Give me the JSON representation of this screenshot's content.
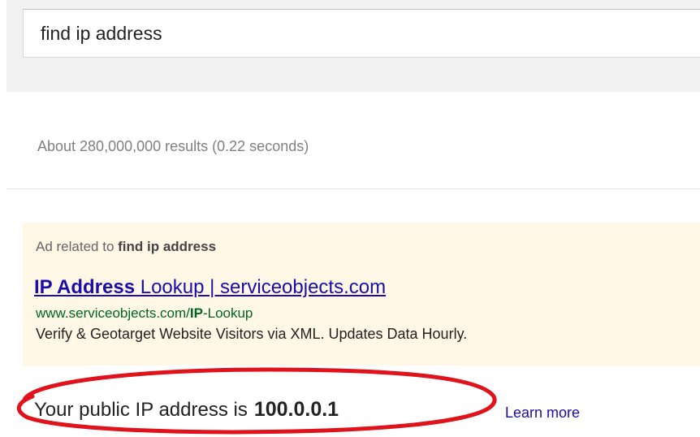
{
  "search": {
    "query": "find ip address"
  },
  "results": {
    "stats": "About 280,000,000 results (0.22 seconds)"
  },
  "ad": {
    "label_prefix": "Ad related to ",
    "label_query": "find ip address",
    "title_bold": "IP Address",
    "title_rest": " Lookup | serviceobjects.com",
    "url_prefix": "www.serviceobjects.com/",
    "url_bold": "IP",
    "url_suffix": "-Lookup",
    "description": "Verify & Geotarget Website Visitors via XML. Updates Data Hourly."
  },
  "ip_answer": {
    "label": "Your public IP address is",
    "value": "100.0.0.1",
    "learn_more": "Learn more"
  },
  "colors": {
    "link": "#1a0dab",
    "url_green": "#006621",
    "ad_background": "#fff8e7",
    "highlight_red": "#e0121b"
  }
}
